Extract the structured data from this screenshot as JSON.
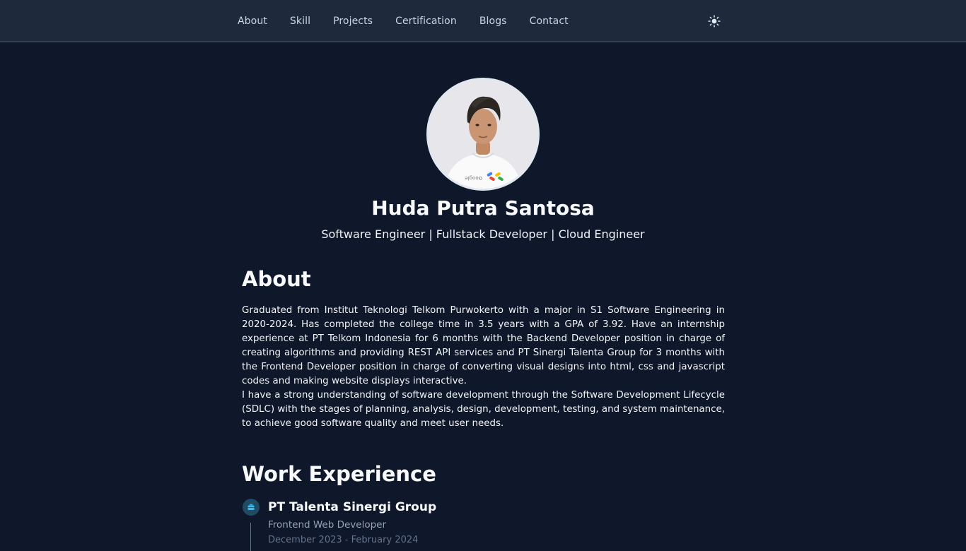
{
  "nav": {
    "items": [
      {
        "label": "About"
      },
      {
        "label": "Skill"
      },
      {
        "label": "Projects"
      },
      {
        "label": "Certification"
      },
      {
        "label": "Blogs"
      },
      {
        "label": "Contact"
      }
    ],
    "theme_icon": "sun-icon"
  },
  "profile": {
    "name": "Huda Putra Santosa",
    "tagline": "Software Engineer | Fullstack Developer | Cloud Engineer",
    "avatar_icon": "profile-photo"
  },
  "about": {
    "title": "About",
    "paragraph1": "Graduated from Institut Teknologi Telkom Purwokerto with a major in S1 Software Engineering in 2020-2024. Has completed the college time in 3.5 years with a GPA of 3.92. Have an internship experience at PT Telkom Indonesia for 6 months with the Backend Developer position in charge of creating algorithms and providing REST API services and PT Sinergi Talenta Group for 3 months with the Frontend Developer position in charge of converting visual designs into html, css and javascript codes and making website displays interactive.",
    "paragraph2": "I have a strong understanding of software development through the Software Development Lifecycle (SDLC) with the stages of planning, analysis, design, development, testing, and system maintenance, to achieve good software quality and meet user needs."
  },
  "work": {
    "title": "Work Experience",
    "jobs": [
      {
        "company": "PT Talenta Sinergi Group",
        "role": "Frontend Web Developer",
        "date": "December 2023 - February 2024",
        "icon": "briefcase-icon"
      }
    ]
  },
  "colors": {
    "background": "#0f172a",
    "navbar": "#1e293b",
    "accent_dot": "#1f4b63",
    "accent_icon": "#38bdf8"
  }
}
